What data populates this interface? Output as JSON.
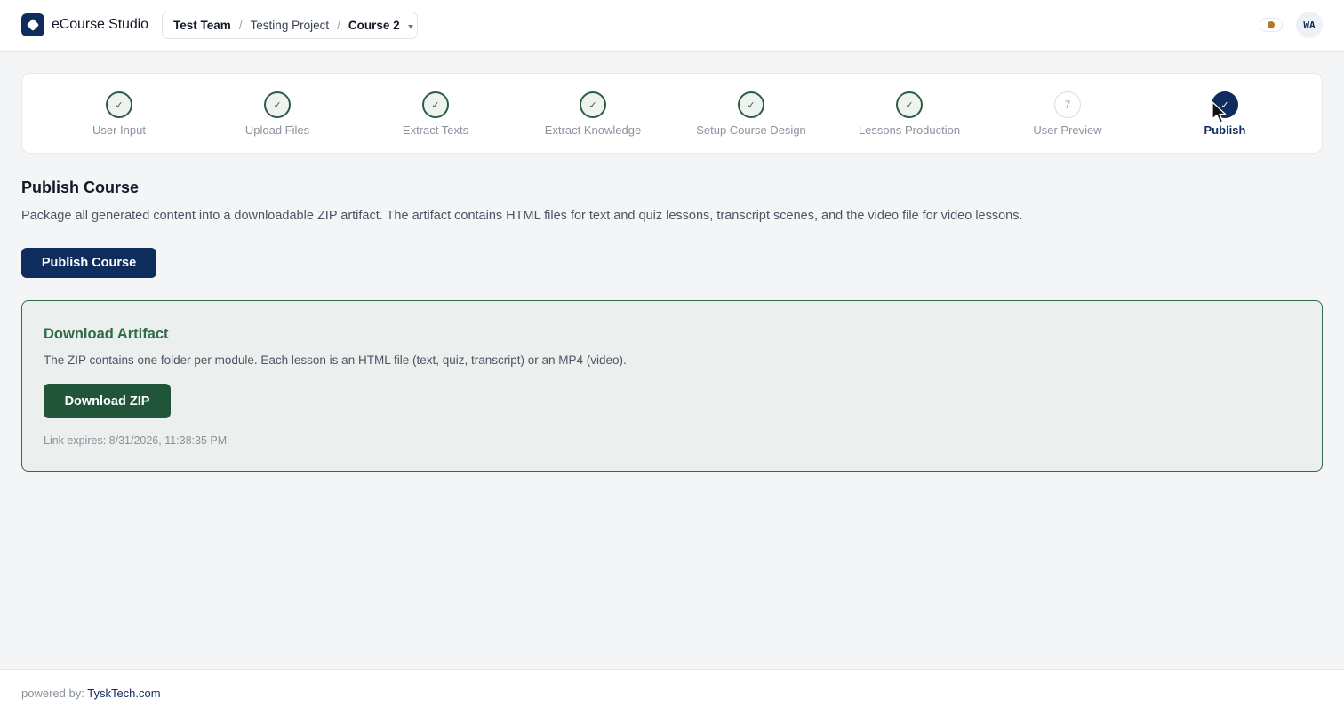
{
  "header": {
    "app_title": "eCourse Studio",
    "breadcrumb": {
      "team": "Test Team",
      "project": "Testing Project",
      "course": "Course 2",
      "separator": "/"
    },
    "status_color": "#b7791f",
    "avatar_initials": "WA"
  },
  "stepper": {
    "steps": [
      {
        "label": "User Input",
        "marker": "✓",
        "state": "done"
      },
      {
        "label": "Upload Files",
        "marker": "✓",
        "state": "done"
      },
      {
        "label": "Extract Texts",
        "marker": "✓",
        "state": "done"
      },
      {
        "label": "Extract Knowledge",
        "marker": "✓",
        "state": "done"
      },
      {
        "label": "Setup Course Design",
        "marker": "✓",
        "state": "done"
      },
      {
        "label": "Lessons Production",
        "marker": "✓",
        "state": "done"
      },
      {
        "label": "User Preview",
        "marker": "7",
        "state": "pending"
      },
      {
        "label": "Publish",
        "marker": "✓",
        "state": "current"
      }
    ]
  },
  "main": {
    "title": "Publish Course",
    "description": "Package all generated content into a downloadable ZIP artifact. The artifact contains HTML files for text and quiz lessons, transcript scenes, and the video file for video lessons.",
    "publish_button": "Publish Course",
    "artifact": {
      "title": "Download Artifact",
      "description": "The ZIP contains one folder per module. Each lesson is an HTML file (text, quiz, transcript) or an MP4 (video).",
      "download_button": "Download ZIP",
      "expires": "Link expires: 8/31/2026, 11:38:35 PM"
    }
  },
  "footer": {
    "prefix": "powered by:",
    "link": "TyskTech.com"
  },
  "colors": {
    "primary": "#0f2d5c",
    "success": "#21553a",
    "success_border": "#2f6b45"
  }
}
